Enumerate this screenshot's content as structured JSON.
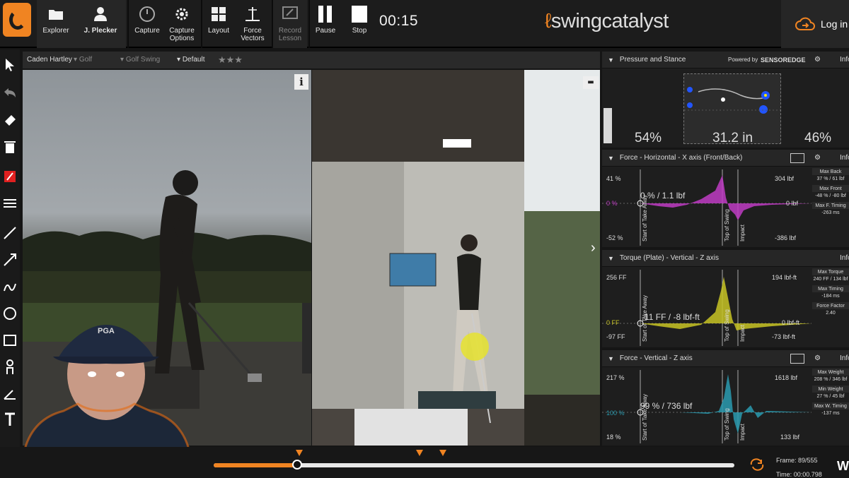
{
  "toolbar": {
    "explorer": "Explorer",
    "user": "J. Plecker",
    "capture": "Capture",
    "capture_options": "Capture Options",
    "layout": "Layout",
    "force_vectors": "Force Vectors",
    "record_lesson": "Record Lesson",
    "pause": "Pause",
    "stop": "Stop",
    "timer": "00:15",
    "brand": "swingcatalyst",
    "login": "Log in"
  },
  "video_header": {
    "player": "Caden Hartley",
    "sport": "Golf",
    "category": "Golf Swing",
    "preset": "Default",
    "rating": "★★★"
  },
  "pressure": {
    "title": "Pressure and Stance",
    "powered_by": "Powered by",
    "vendor": "SENSOREDGE",
    "info": "Info",
    "left_pct": "54%",
    "stance_width": "31.2 in",
    "right_pct": "46%"
  },
  "force_horizontal": {
    "title": "Force - Horizontal - X axis (Front/Back)",
    "info": "Info",
    "y_top": "41 %",
    "y_zero": "0 %",
    "y_bottom": "-52 %",
    "right_top": "304 lbf",
    "right_zero": "0 lbf",
    "right_bottom": "-386 lbf",
    "readout": "0 % / 1.1 lbf",
    "stats": [
      {
        "label": "Max Back",
        "value": "37 % / 61 lbf"
      },
      {
        "label": "Max Front",
        "value": "-48 % / -80 lbf"
      },
      {
        "label": "Max F. Timing",
        "value": "-263 ms"
      }
    ]
  },
  "torque": {
    "title": "Torque (Plate) - Vertical - Z axis",
    "info": "Info",
    "y_top": "256 FF",
    "y_zero": "0 FF",
    "y_bottom": "-97 FF",
    "right_top": "194 lbf-ft",
    "right_zero": "0 lbf-ft",
    "right_bottom": "-73 lbf-ft",
    "readout": "-11 FF / -8 lbf-ft",
    "stats": [
      {
        "label": "Max Torque",
        "value": "240 FF / 134 lbf"
      },
      {
        "label": "Max Timing",
        "value": "-184 ms"
      },
      {
        "label": "Force Factor",
        "value": "2.40"
      }
    ]
  },
  "force_vertical": {
    "title": "Force - Vertical - Z axis",
    "info": "Info",
    "y_top": "217 %",
    "y_mid": "100 %",
    "y_bottom": "18 %",
    "right_top": "1618 lbf",
    "right_bottom": "133 lbf",
    "readout": "99 % / 736 lbf",
    "stats": [
      {
        "label": "Max Weight",
        "value": "208 % / 346 lbf"
      },
      {
        "label": "Min Weight",
        "value": "27 % / 45 lbf"
      },
      {
        "label": "Max W. Timing",
        "value": "-137 ms"
      }
    ]
  },
  "phase_labels": {
    "takeaway": "Start of Take Away",
    "top": "Top of Swing",
    "impact": "Impact"
  },
  "timeline": {
    "progress": 0.16,
    "markers": [
      0.164,
      0.395,
      0.44
    ],
    "frame_label": "Frame:",
    "frame": "89/555",
    "time_label": "Time:",
    "time": "00:00.798"
  },
  "colors": {
    "accent": "#f08422",
    "horizontal": "#c03cc4",
    "torque": "#c8c424",
    "vertical": "#2a9bb0"
  }
}
